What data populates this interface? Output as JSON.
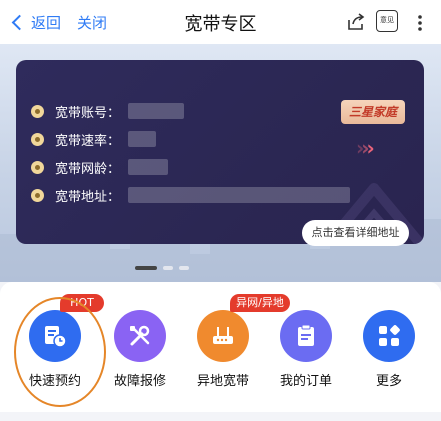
{
  "nav": {
    "back_label": "返回",
    "close_label": "关闭",
    "title": "宽带专区",
    "feedback_label": "意见"
  },
  "card": {
    "fields": [
      {
        "label": "宽带账号："
      },
      {
        "label": "宽带速率："
      },
      {
        "label": "宽带网龄："
      },
      {
        "label": "宽带地址："
      }
    ],
    "brand_badge": "三星家庭",
    "view_address_label": "点击查看详细地址"
  },
  "services": [
    {
      "label": "快速预约",
      "tag": "HOT",
      "icon": "calendar-clock-icon",
      "color": "#2f6cf0"
    },
    {
      "label": "故障报修",
      "tag": "",
      "icon": "tools-icon",
      "color": "#8a63f3"
    },
    {
      "label": "异地宽带",
      "tag": "异网/异地",
      "icon": "router-icon",
      "color": "#f08a2e"
    },
    {
      "label": "我的订单",
      "tag": "",
      "icon": "clipboard-icon",
      "color": "#6b6cf2"
    },
    {
      "label": "更多",
      "tag": "",
      "icon": "grid-icon",
      "color": "#2f6cf0"
    }
  ],
  "colors": {
    "accent": "#2f7bf5",
    "card_bg": "#2b2753",
    "hot_tag": "#e43b2c",
    "annotation": "#e58628"
  }
}
